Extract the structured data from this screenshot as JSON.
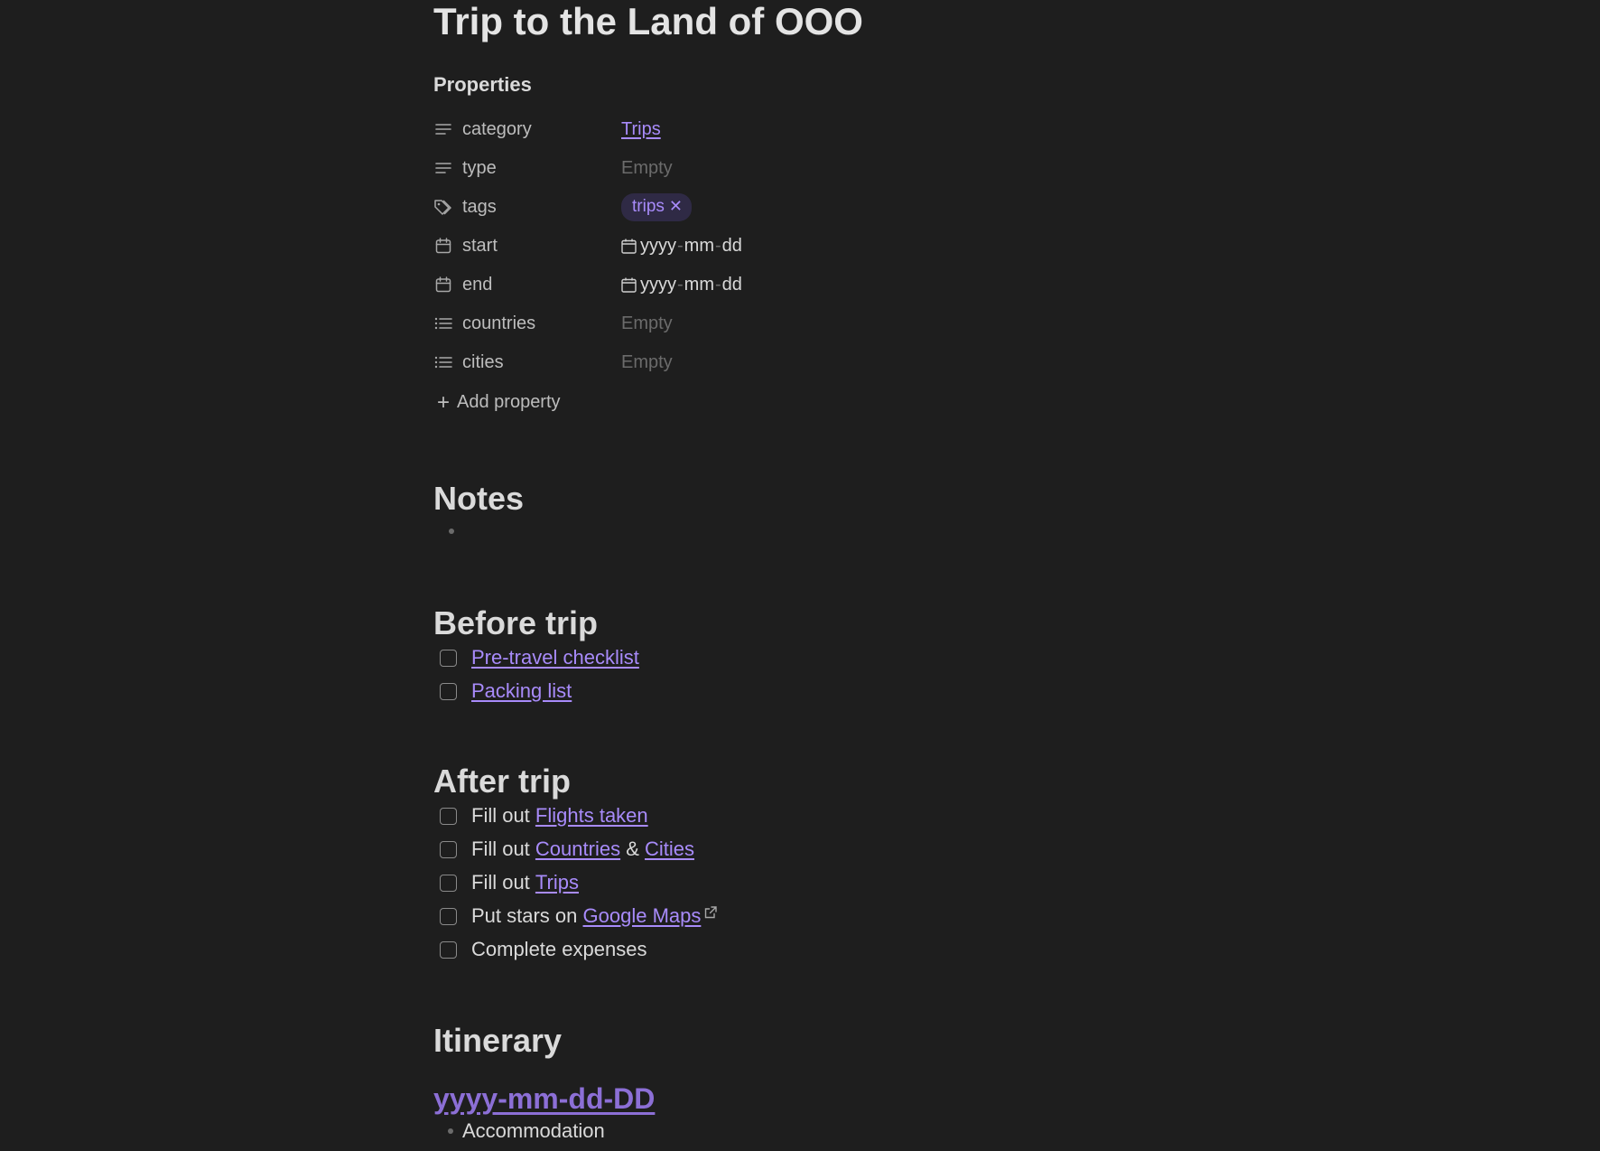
{
  "title": "Trip to the Land of OOO",
  "properties": {
    "heading": "Properties",
    "items": [
      {
        "key": "category",
        "icon": "text-lines-icon",
        "value": "Trips",
        "kind": "link"
      },
      {
        "key": "type",
        "icon": "text-lines-icon",
        "value": "Empty",
        "kind": "empty"
      },
      {
        "key": "tags",
        "icon": "tags-icon",
        "value": "trips",
        "kind": "tag"
      },
      {
        "key": "start",
        "icon": "calendar-icon",
        "value": [
          "yyyy",
          "mm",
          "dd"
        ],
        "kind": "date"
      },
      {
        "key": "end",
        "icon": "calendar-icon",
        "value": [
          "yyyy",
          "mm",
          "dd"
        ],
        "kind": "date"
      },
      {
        "key": "countries",
        "icon": "list-icon",
        "value": "Empty",
        "kind": "empty"
      },
      {
        "key": "cities",
        "icon": "list-icon",
        "value": "Empty",
        "kind": "empty"
      }
    ],
    "add_label": "Add property"
  },
  "notes": {
    "heading": "Notes"
  },
  "before_trip": {
    "heading": "Before trip",
    "tasks": [
      {
        "link": "Pre-travel checklist"
      },
      {
        "link": "Packing list"
      }
    ]
  },
  "after_trip": {
    "heading": "After trip",
    "tasks": [
      {
        "prefix": "Fill out ",
        "link": "Flights taken"
      },
      {
        "prefix": "Fill out ",
        "link": "Countries",
        "mid": " & ",
        "link2": "Cities"
      },
      {
        "prefix": "Fill out ",
        "link": "Trips"
      },
      {
        "prefix": "Put stars on ",
        "link": "Google Maps",
        "external": true
      },
      {
        "prefix": "Complete expenses"
      }
    ]
  },
  "itinerary": {
    "heading": "Itinerary",
    "date_heading": "yyyy-mm-dd-DD",
    "items": [
      "Accommodation"
    ]
  },
  "colors": {
    "background": "#1e1e1e",
    "link": "#a88bfa",
    "tag_bg": "#2f2a45",
    "muted": "#6b6b6b"
  }
}
